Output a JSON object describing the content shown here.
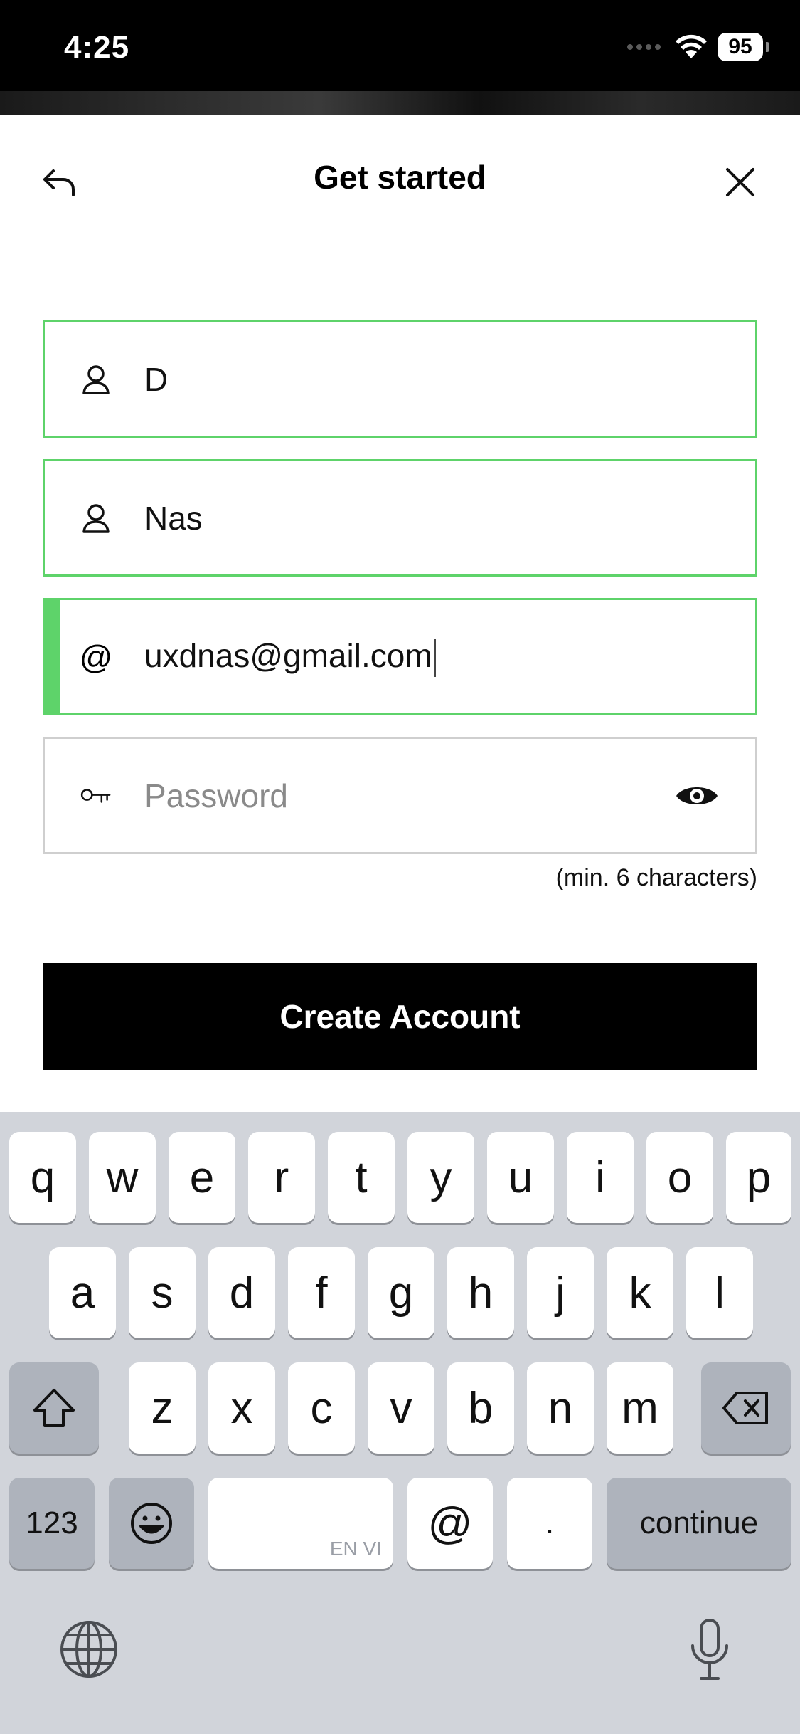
{
  "status_bar": {
    "time": "4:25",
    "battery": "95"
  },
  "header": {
    "title": "Get started"
  },
  "form": {
    "first_name": {
      "value": "D",
      "icon": "person-icon"
    },
    "last_name": {
      "value": "Nas",
      "icon": "person-icon"
    },
    "email": {
      "value": "uxdnas@gmail.com",
      "icon": "at-icon",
      "icon_glyph": "@"
    },
    "password": {
      "value": "",
      "placeholder": "Password",
      "icon": "key-icon"
    },
    "password_hint": "(min. 6 characters)"
  },
  "cta": {
    "label": "Create Account"
  },
  "colors": {
    "accent_green": "#5ed36a",
    "neutral_border": "#cfcfcf",
    "button_bg": "#000000",
    "keyboard_bg": "#d1d4da"
  },
  "keyboard": {
    "row1": [
      "q",
      "w",
      "e",
      "r",
      "t",
      "y",
      "u",
      "i",
      "o",
      "p"
    ],
    "row2": [
      "a",
      "s",
      "d",
      "f",
      "g",
      "h",
      "j",
      "k",
      "l"
    ],
    "row3": [
      "z",
      "x",
      "c",
      "v",
      "b",
      "n",
      "m"
    ],
    "numbers_label": "123",
    "space_hint": "EN VI",
    "at_label": "@",
    "dot_label": ".",
    "continue_label": "continue"
  }
}
